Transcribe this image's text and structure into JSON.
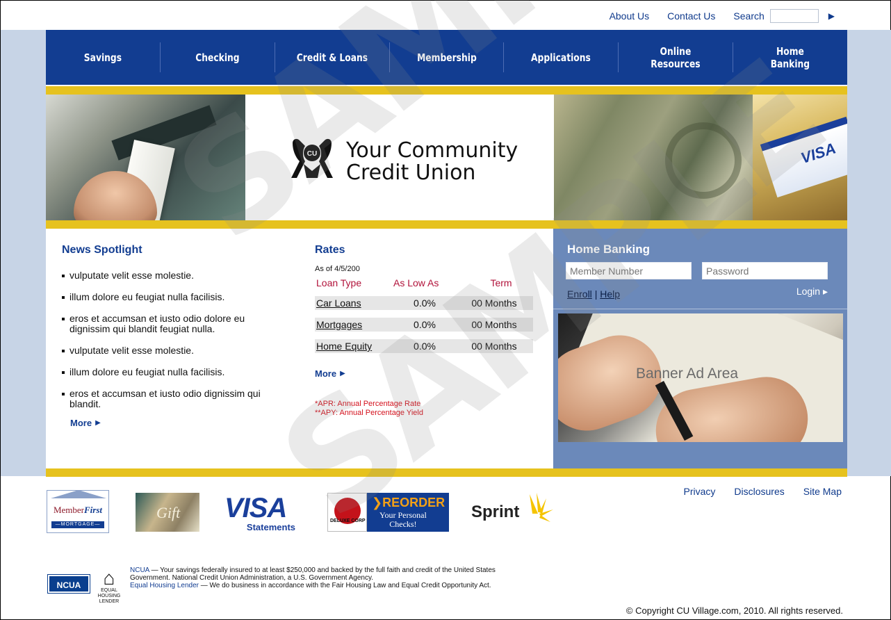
{
  "util": {
    "about": "About Us",
    "contact": "Contact Us",
    "search_label": "Search",
    "search_go": "▶"
  },
  "nav": [
    {
      "label": "Savings"
    },
    {
      "label": "Checking"
    },
    {
      "label": "Credit & Loans"
    },
    {
      "label": "Membership"
    },
    {
      "label": "Applications"
    },
    {
      "label_line1": "Online",
      "label_line2": "Resources"
    },
    {
      "label_line1": "Home",
      "label_line2": "Banking"
    }
  ],
  "hero": {
    "logo_line1": "Your Community",
    "logo_line2": "Credit Union",
    "logo_mark_text": "CU",
    "card_text": "VISA"
  },
  "news": {
    "title": "News Spotlight",
    "items": [
      "vulputate velit esse molestie.",
      "illum dolore eu feugiat nulla facilisis.",
      "eros et accumsan et iusto odio dolore eu dignissim qui blandit feugiat nulla.",
      "vulputate velit esse molestie.",
      "illum dolore eu feugiat nulla facilisis.",
      "eros et accumsan et iusto odio dignissim qui blandit."
    ],
    "more": "More"
  },
  "rates": {
    "title": "Rates",
    "as_of": "As of 4/5/200",
    "headers": [
      "Loan Type",
      "As Low As",
      "Term"
    ],
    "rows": [
      {
        "type": "Car Loans",
        "rate": "0.0%",
        "term": "00 Months"
      },
      {
        "type": "Mortgages",
        "rate": "0.0%",
        "term": "00 Months"
      },
      {
        "type": "Home Equity",
        "rate": "0.0%",
        "term": "00 Months"
      }
    ],
    "more": "More",
    "note_apr": "*APR: Annual Percentage Rate",
    "note_apy": "**APY: Annual Percentage Yield"
  },
  "home_banking": {
    "title": "Home Banking",
    "member_placeholder": "Member Number",
    "password_placeholder": "Password",
    "enroll": "Enroll",
    "sep": "|",
    "help": "Help",
    "login": "Login ▸",
    "banner_label": "Banner Ad Area"
  },
  "footer": {
    "links": [
      "Privacy",
      "Disclosures",
      "Site Map"
    ],
    "partners": {
      "memberfirst_a": "Member",
      "memberfirst_b": "First",
      "memberfirst_sub": "—MORTGAGE—",
      "gift": "Gift",
      "visa": "VISA",
      "visa_sub": "Statements",
      "deluxe_brand": "DELUXE CORP",
      "reorder": "❯REORDER",
      "reorder_sub1": "Your Personal",
      "reorder_sub2": "Checks!",
      "sprint": "Sprint"
    },
    "ncua_logo": "NCUA",
    "ehl_label": "EQUAL HOUSING LENDER",
    "legal_ncua": "NCUA",
    "legal_text1": " — Your savings federally insured to at least $250,000 and backed by the full faith and credit of the United States Government. National Credit Union Administration, a U.S. Government Agency.",
    "legal_ehl": "Equal Housing Lender",
    "legal_text2": " — We do business in accordance with the Fair Housing Law and Equal Credit Opportunity Act.",
    "copyright": "© Copyright CU Village.com, 2010. All rights reserved."
  },
  "watermark": "SAMPLE",
  "colors": {
    "nav_blue": "#123d91",
    "gold": "#e6c21e",
    "panel_blue": "#6b89ba",
    "rate_red": "#b1123a",
    "page_bg": "#c7d4e6"
  }
}
